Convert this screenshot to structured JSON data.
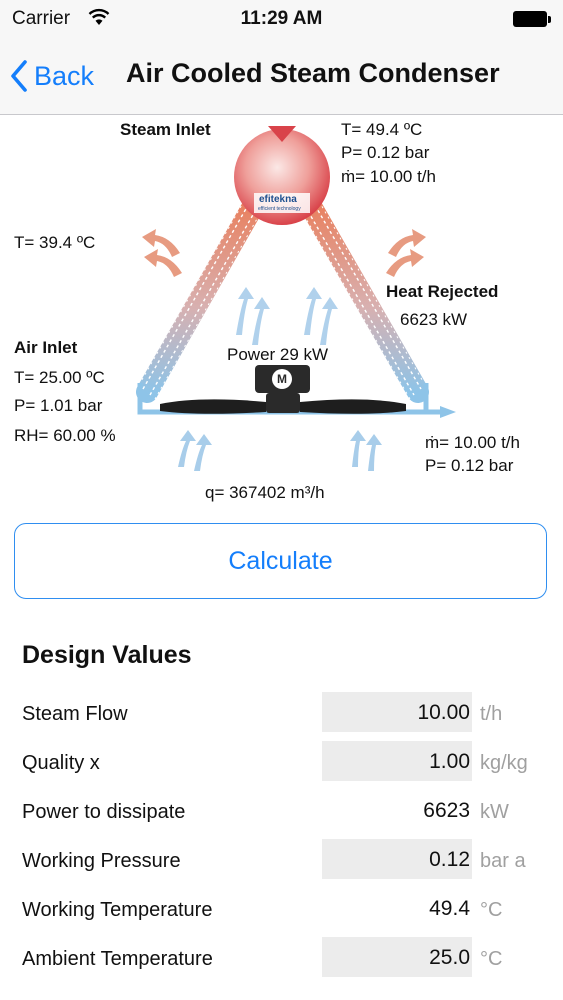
{
  "status_bar": {
    "carrier": "Carrier",
    "time": "11:29 AM"
  },
  "nav": {
    "back_label": "Back",
    "title": "Air Cooled Steam Condenser"
  },
  "diagram": {
    "steam_inlet_title": "Steam Inlet",
    "steam_temp": "T= 49.4 ºC",
    "steam_pressure": "P= 0.12 bar",
    "steam_flow": "ṁ= 10.00 t/h",
    "logo_name": "efitekna",
    "logo_tagline": "efficient technology",
    "hot_air_temp": "T= 39.4 ºC",
    "heat_rejected_title": "Heat Rejected",
    "heat_rejected_value": "6623 kW",
    "air_inlet_title": "Air Inlet",
    "air_temp": "T= 25.00 ºC",
    "air_pressure": "P= 1.01 bar",
    "air_rh": "RH= 60.00 %",
    "power": "Power 29 kW",
    "motor_letter": "M",
    "condensate_flow": "ṁ= 10.00 t/h",
    "condensate_pressure": "P= 0.12 bar",
    "air_flow": "q= 367402 m³/h"
  },
  "calculate_label": "Calculate",
  "design_values": {
    "title": "Design Values",
    "rows": [
      {
        "label": "Steam Flow",
        "value": "10.00",
        "unit": "t/h",
        "editable": true
      },
      {
        "label": "Quality  x",
        "value": "1.00",
        "unit": "kg/kg",
        "editable": true
      },
      {
        "label": "Power to dissipate",
        "value": "6623",
        "unit": "kW",
        "editable": false
      },
      {
        "label": "Working Pressure",
        "value": "0.12",
        "unit": "bar a",
        "editable": true
      },
      {
        "label": "Working Temperature",
        "value": "49.4",
        "unit": "°C",
        "editable": false
      },
      {
        "label": "Ambient Temperature",
        "value": "25.0",
        "unit": "°C",
        "editable": true
      }
    ]
  },
  "colors": {
    "accent": "#147efb",
    "tube_hot": "#e07a5a",
    "tube_cold": "#8ec4e8",
    "drum": "#d9434a",
    "field_bg": "#ececec"
  }
}
